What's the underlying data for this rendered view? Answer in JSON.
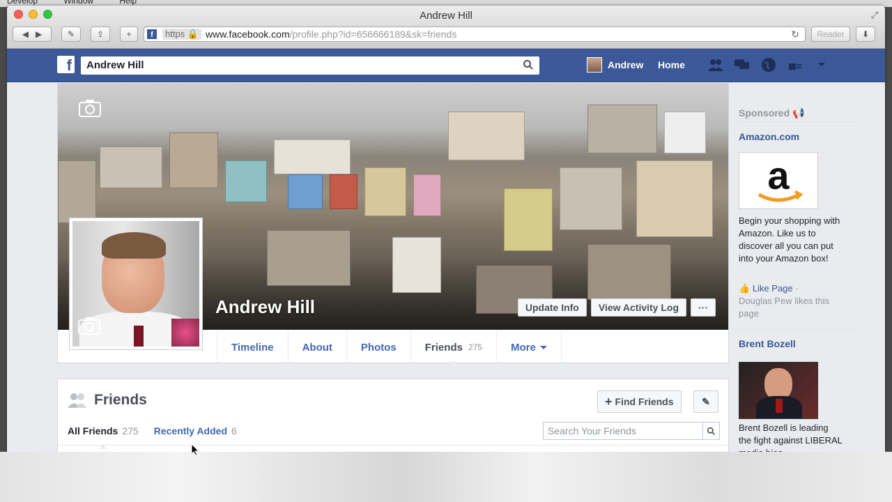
{
  "menubar": {
    "items": [
      "Develop",
      "Window",
      "Help"
    ]
  },
  "browser": {
    "window_title": "Andrew Hill",
    "address": {
      "scheme": "https",
      "host": "www.facebook.com",
      "path": "/profile.php?id=656666189&sk=friends"
    },
    "reader_label": "Reader"
  },
  "fb": {
    "search_value": "Andrew Hill",
    "nav_user": "Andrew",
    "nav_home": "Home",
    "brand_color": "#3b5998"
  },
  "profile": {
    "name": "Andrew Hill",
    "buttons": {
      "update_info": "Update Info",
      "activity_log": "View Activity Log",
      "more": "···"
    },
    "tabs": [
      {
        "label": "Timeline"
      },
      {
        "label": "About"
      },
      {
        "label": "Photos"
      },
      {
        "label": "Friends",
        "count": "275"
      },
      {
        "label": "More"
      }
    ]
  },
  "friends": {
    "title": "Friends",
    "find_friends": "Find Friends",
    "subtabs": [
      {
        "label": "All Friends",
        "count": "275"
      },
      {
        "label": "Recently Added",
        "count": "6"
      }
    ],
    "search_placeholder": "Search Your Friends"
  },
  "sidebar": {
    "sponsored": "Sponsored",
    "ads": [
      {
        "title": "Amazon.com",
        "text": "Begin your shopping with Amazon. Like us to discover all you can put into your Amazon box!",
        "like_page": "Like Page",
        "likes_text": "Douglas Pew likes this page"
      },
      {
        "title": "Brent Bozell",
        "text": "Brent Bozell is leading the fight against LIBERAL media bias."
      }
    ]
  }
}
